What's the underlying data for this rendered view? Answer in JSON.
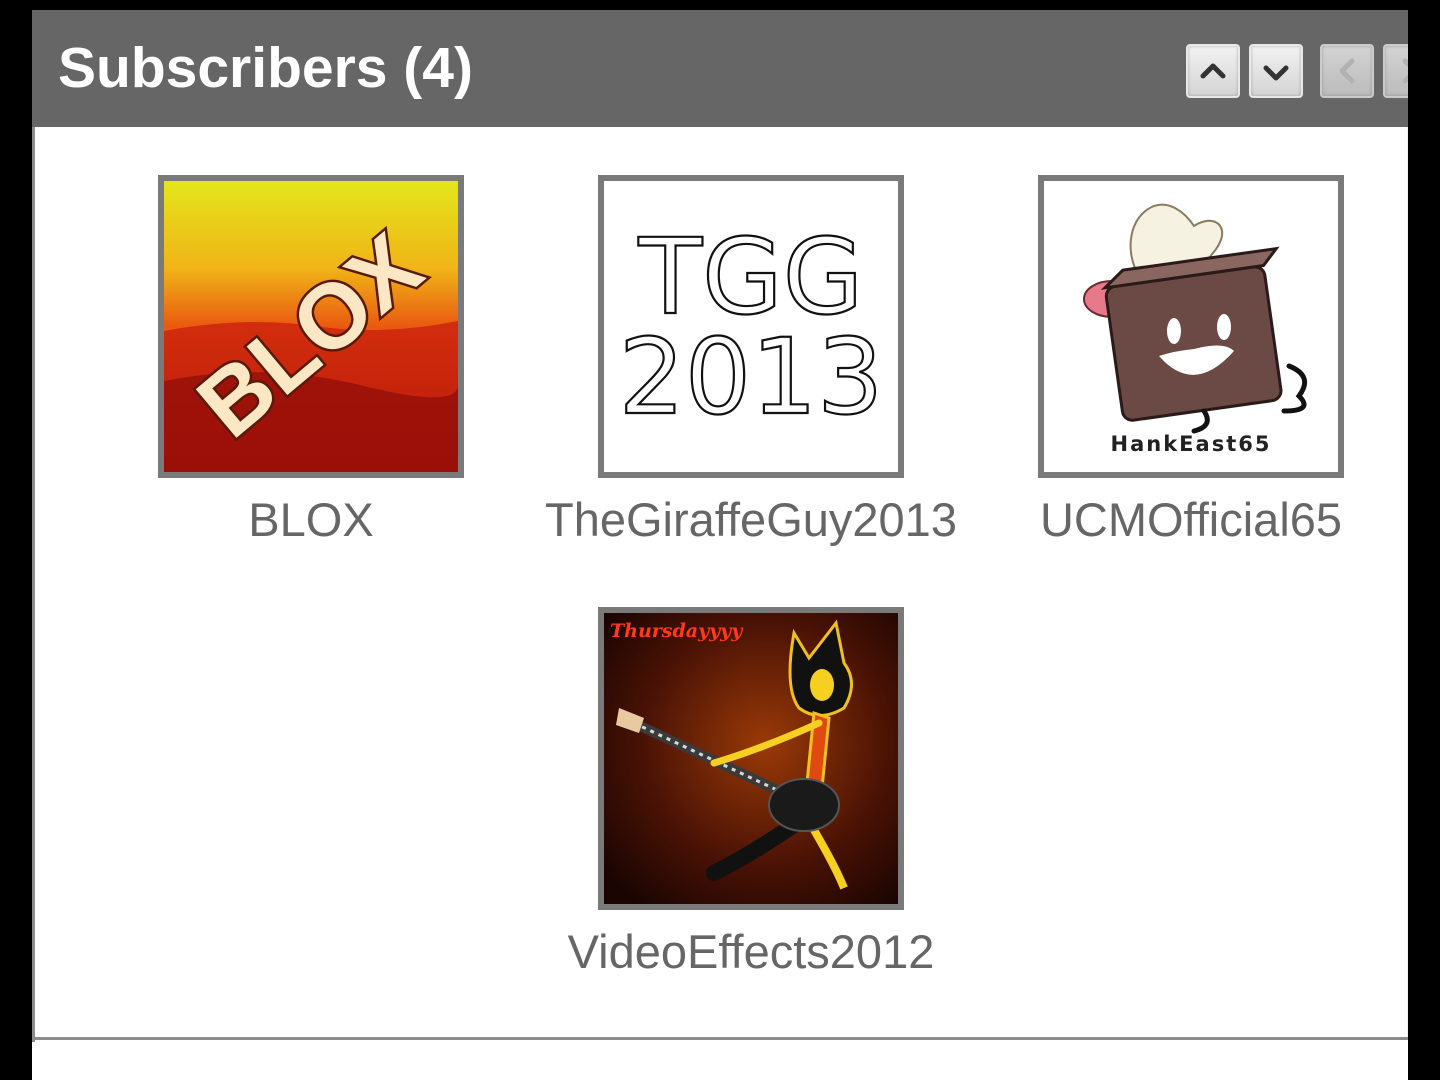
{
  "header": {
    "title": "Subscribers (4)"
  },
  "nav": {
    "buttons": [
      {
        "name": "scroll-up",
        "icon": "chevron-up-icon"
      },
      {
        "name": "scroll-down",
        "icon": "chevron-down-icon"
      },
      {
        "name": "previous-page",
        "icon": "chevron-left-icon",
        "disabled": true
      },
      {
        "name": "next-page",
        "icon": "chevron-right-icon",
        "disabled": true
      }
    ]
  },
  "subscribers": [
    {
      "name": "BLOX",
      "avatar_text": "BLOX"
    },
    {
      "name": "TheGiraffeGuy2013",
      "avatar_text_line1": "TGG",
      "avatar_text_line2": "2013"
    },
    {
      "name": "UCMOfficial65",
      "avatar_caption": "HankEast65"
    },
    {
      "name": "VideoEffects2012",
      "avatar_caption": "Thursdayyyy"
    }
  ],
  "colors": {
    "header_bg": "#666666",
    "header_text": "#ffffff",
    "name_text": "#666666",
    "thumb_border": "#7a7a7a",
    "page_bg": "#000000"
  }
}
